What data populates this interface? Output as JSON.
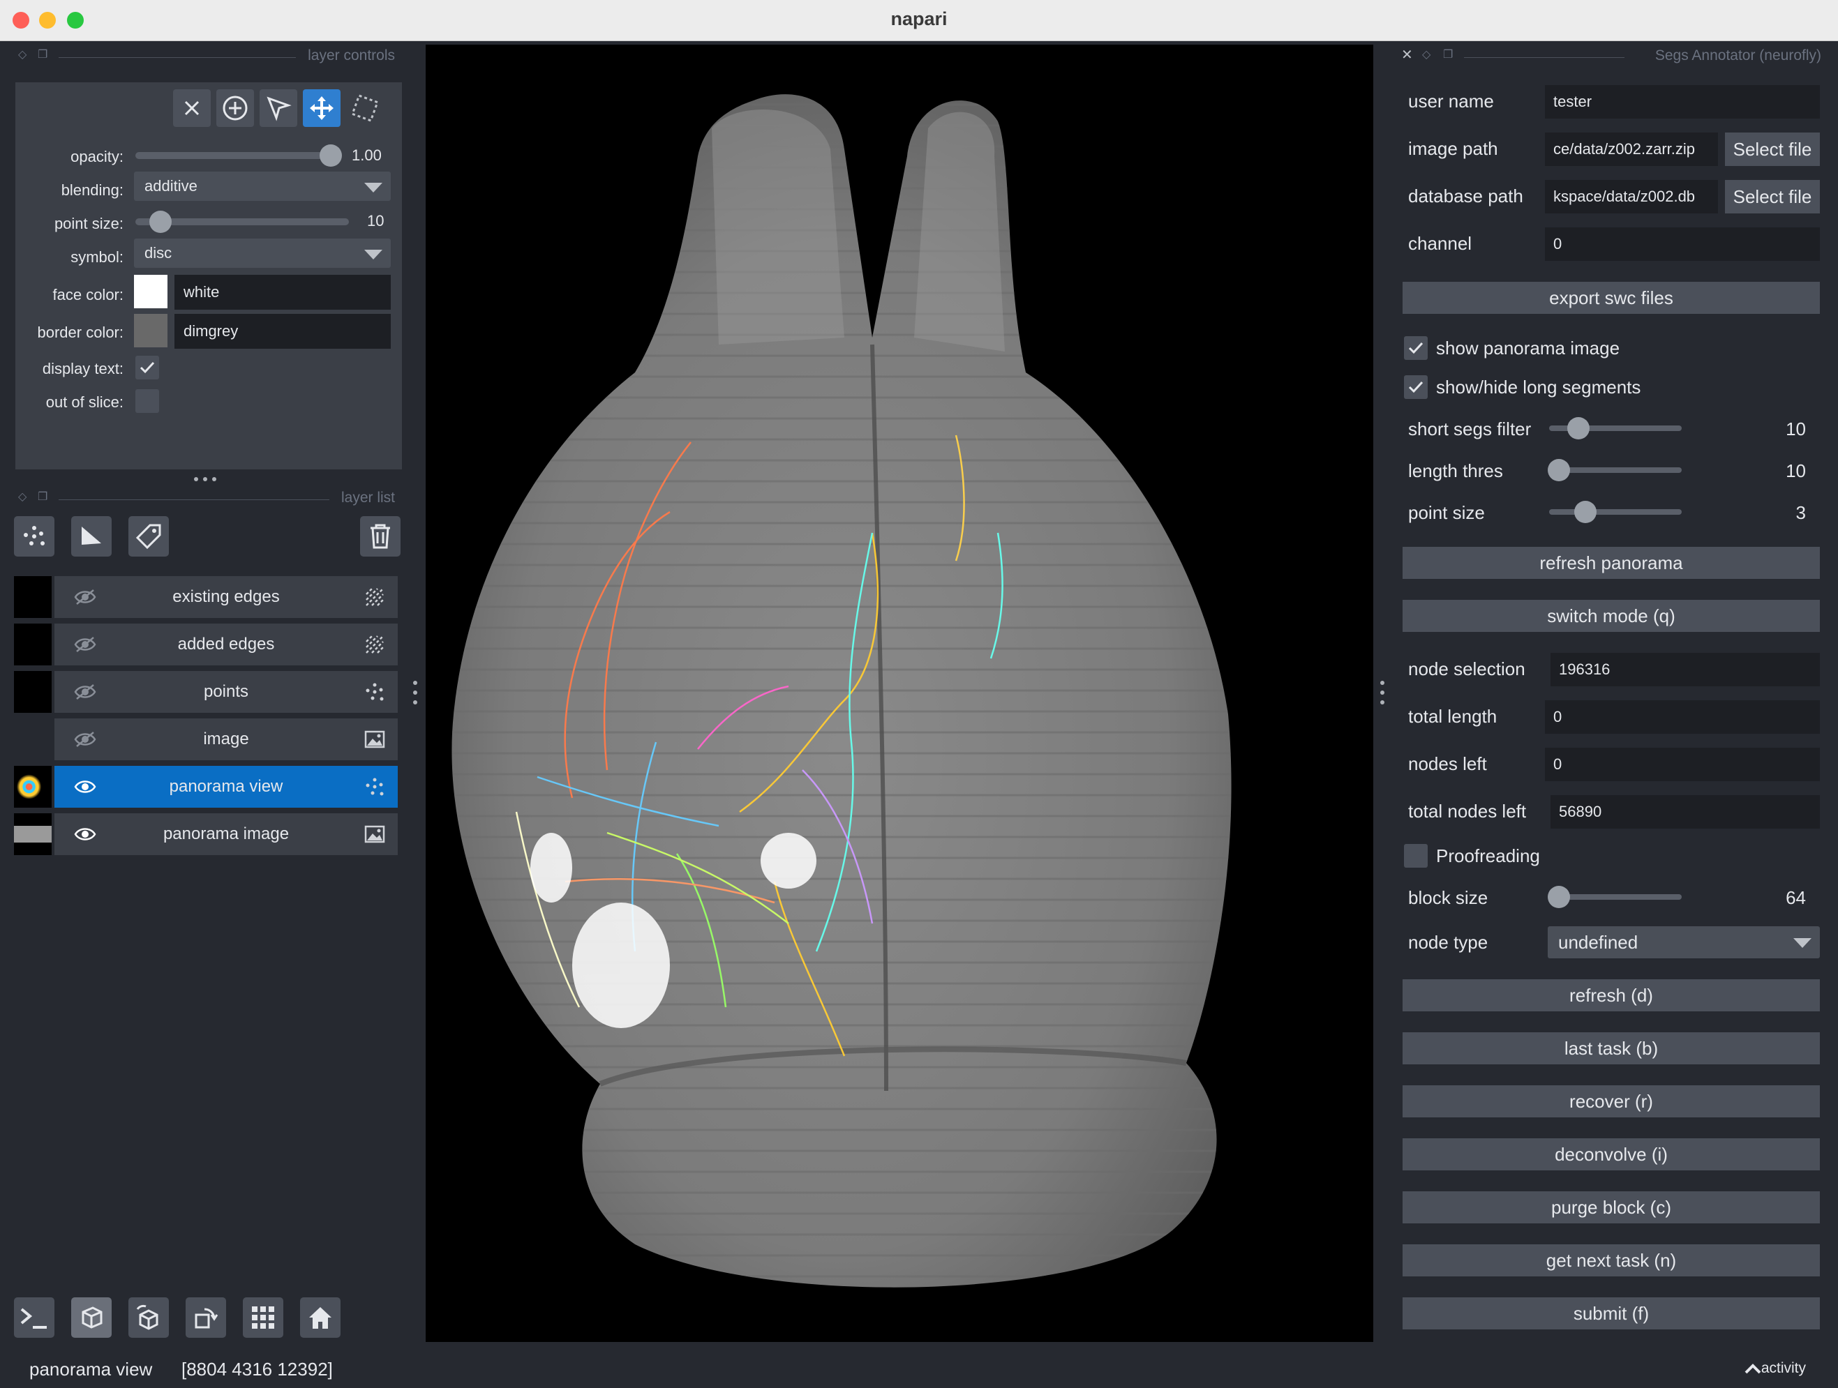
{
  "window": {
    "title": "napari"
  },
  "panels": {
    "layer_controls_title": "layer controls",
    "layer_list_title": "layer list",
    "plugin_title": "Segs Annotator (neurofly)"
  },
  "layer_controls": {
    "opacity_label": "opacity:",
    "opacity_value": "1.00",
    "opacity_fraction": 1.0,
    "blending_label": "blending:",
    "blending_value": "additive",
    "point_size_label": "point size:",
    "point_size_value": "10",
    "symbol_label": "symbol:",
    "symbol_value": "disc",
    "face_color_label": "face color:",
    "face_color_value": "white",
    "face_color_swatch": "#ffffff",
    "border_color_label": "border color:",
    "border_color_value": "dimgrey",
    "border_color_swatch": "#696969",
    "display_text_label": "display text:",
    "display_text_checked": true,
    "out_of_slice_label": "out of slice:",
    "out_of_slice_checked": false
  },
  "layers": [
    {
      "name": "existing edges",
      "visible": false,
      "type_icon": "shapes-icon",
      "selected": false
    },
    {
      "name": "added edges",
      "visible": false,
      "type_icon": "shapes-icon",
      "selected": false
    },
    {
      "name": "points",
      "visible": false,
      "type_icon": "points-icon",
      "selected": false
    },
    {
      "name": "image",
      "visible": false,
      "type_icon": "image-icon",
      "selected": false
    },
    {
      "name": "panorama view",
      "visible": true,
      "type_icon": "points-icon",
      "selected": true
    },
    {
      "name": "panorama image",
      "visible": true,
      "type_icon": "image-icon",
      "selected": false
    }
  ],
  "plugin": {
    "user_name_label": "user name",
    "user_name_value": "tester",
    "image_path_label": "image path",
    "image_path_value": "ce/data/z002.zarr.zip",
    "database_path_label": "database path",
    "database_path_value": "kspace/data/z002.db",
    "select_file_label": "Select file",
    "channel_label": "channel",
    "channel_value": "0",
    "export_swc_label": "export swc files",
    "show_panorama_label": "show panorama image",
    "show_panorama_checked": true,
    "show_long_label": "show/hide long segments",
    "show_long_checked": true,
    "short_segs_label": "short segs filter",
    "short_segs_value": "10",
    "length_thres_label": "length thres",
    "length_thres_value": "10",
    "point_size_label": "point size",
    "point_size_value": "3",
    "refresh_panorama_label": "refresh panorama",
    "switch_mode_label": "switch mode (q)",
    "node_selection_label": "node selection",
    "node_selection_value": "196316",
    "total_length_label": "total length",
    "total_length_value": "0",
    "nodes_left_label": "nodes left",
    "nodes_left_value": "0",
    "total_nodes_left_label": "total nodes left",
    "total_nodes_left_value": "56890",
    "proofreading_label": "Proofreading",
    "proofreading_checked": false,
    "block_size_label": "block size",
    "block_size_value": "64",
    "node_type_label": "node type",
    "node_type_value": "undefined",
    "refresh_label": "refresh (d)",
    "last_task_label": "last task (b)",
    "recover_label": "recover (r)",
    "deconvolve_label": "deconvolve (i)",
    "purge_block_label": "purge block (c)",
    "get_next_task_label": "get next task (n)",
    "submit_label": "submit (f)"
  },
  "status": {
    "layer": "panorama view",
    "coords": "[8804 4316 12392]",
    "activity_label": "activity"
  },
  "colors": {
    "accent": "#0a6ec4",
    "tool_active": "#2f7fd0",
    "background": "#262930",
    "panel": "#3b3f47"
  }
}
